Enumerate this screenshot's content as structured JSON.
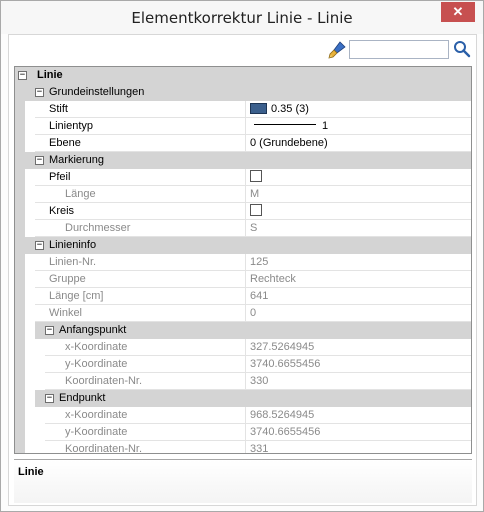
{
  "window": {
    "title": "Elementkorrektur Linie - Linie",
    "close_glyph": "✕"
  },
  "toolbar": {
    "search_value": "",
    "search_placeholder": "",
    "brush_icon": "brush-icon",
    "search_icon": "magnifier-icon"
  },
  "grid": {
    "root": {
      "label": "Linie",
      "toggle": "−"
    },
    "grundeinstellungen": {
      "label": "Grundeinstellungen",
      "toggle": "−",
      "stift_label": "Stift",
      "stift_value": "0.35 (3)",
      "stift_color": "#3b5f8c",
      "linientyp_label": "Linientyp",
      "linientyp_value": "1",
      "ebene_label": "Ebene",
      "ebene_value": "0 (Grundebene)"
    },
    "markierung": {
      "label": "Markierung",
      "toggle": "−",
      "pfeil_label": "Pfeil",
      "pfeil_checked": false,
      "laenge_label": "Länge",
      "laenge_value": "M",
      "kreis_label": "Kreis",
      "kreis_checked": false,
      "durchmesser_label": "Durchmesser",
      "durchmesser_value": "S"
    },
    "linieninfo": {
      "label": "Linieninfo",
      "toggle": "−",
      "nr_label": "Linien-Nr.",
      "nr_value": "125",
      "gruppe_label": "Gruppe",
      "gruppe_value": "Rechteck",
      "laenge_label": "Länge [cm]",
      "laenge_value": "641",
      "winkel_label": "Winkel",
      "winkel_value": "0"
    },
    "anfangspunkt": {
      "label": "Anfangspunkt",
      "toggle": "−",
      "x_label": "x-Koordinate",
      "x_value": "327.5264945",
      "y_label": "y-Koordinate",
      "y_value": "3740.6655456",
      "nr_label": "Koordinaten-Nr.",
      "nr_value": "330"
    },
    "endpunkt": {
      "label": "Endpunkt",
      "toggle": "−",
      "x_label": "x-Koordinate",
      "x_value": "968.5264945",
      "y_label": "y-Koordinate",
      "y_value": "3740.6655456",
      "nr_label": "Koordinaten-Nr.",
      "nr_value": "331"
    }
  },
  "description": {
    "title": "Linie"
  }
}
